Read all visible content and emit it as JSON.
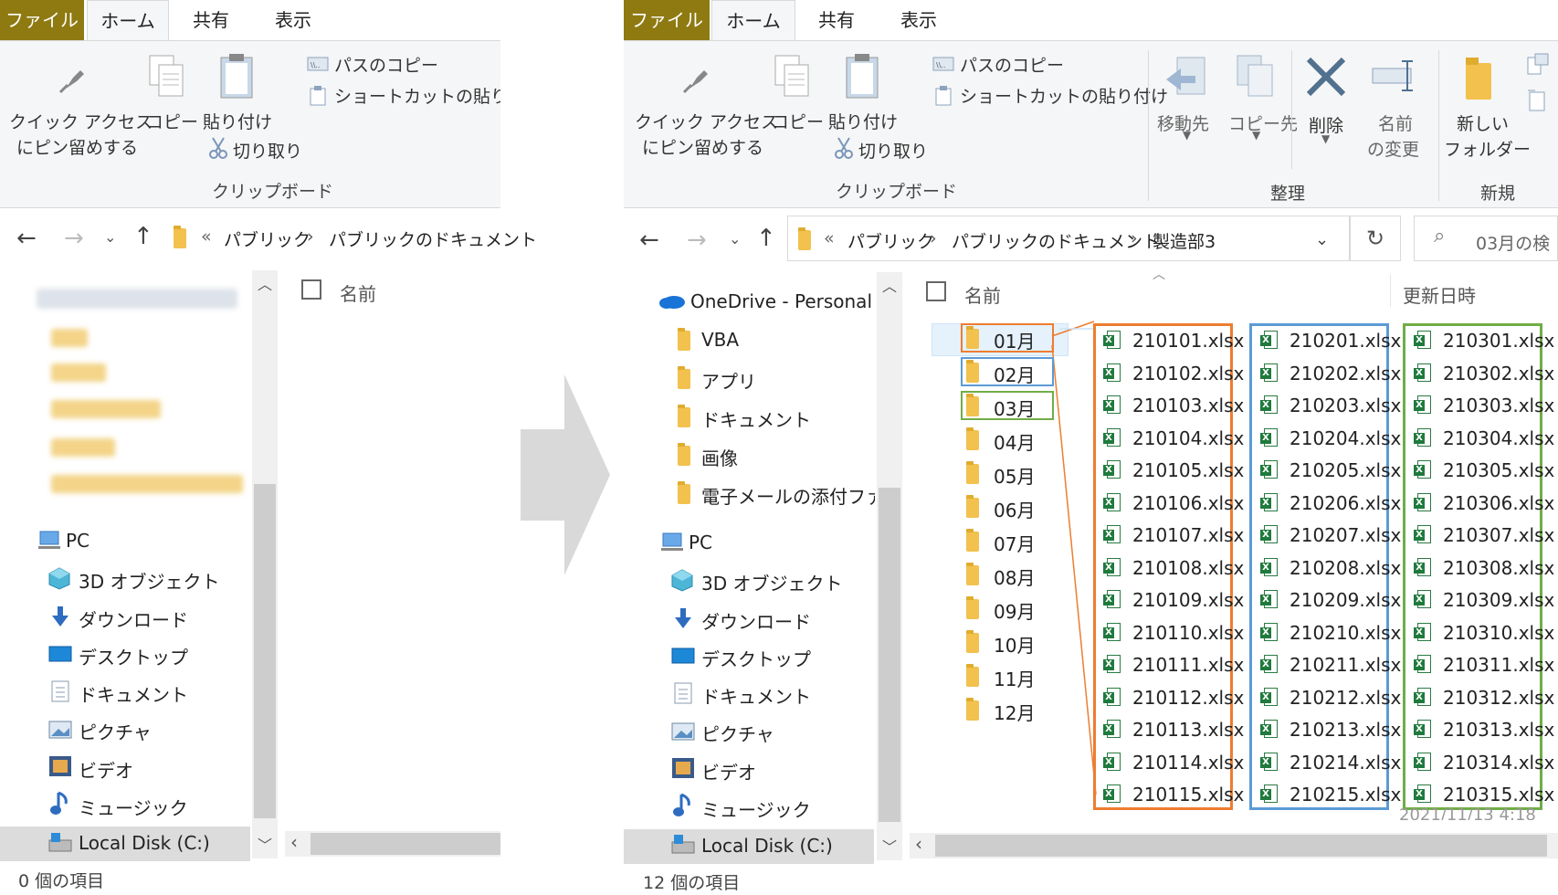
{
  "ribbon": {
    "tabs": [
      "ファイル",
      "ホーム",
      "共有",
      "表示"
    ],
    "pin_label_1": "クイック アクセス",
    "pin_label_2": "にピン留めする",
    "copy": "コピー",
    "paste": "貼り付け",
    "copy_path": "パスのコピー",
    "paste_shortcut_left": "ショートカットの貼り付け",
    "paste_shortcut_right": "ショートカットの貼り付け",
    "cut": "切り取り",
    "clipboard_group": "クリップボード",
    "move_to": "移動先",
    "copy_to": "コピー先",
    "delete": "削除",
    "rename_1": "名前",
    "rename_2": "の変更",
    "organize_group": "整理",
    "new_folder_1": "新しい",
    "new_folder_2": "フォルダー",
    "new_group": "新規"
  },
  "address": {
    "chevrons": "«",
    "left_path": [
      "パブリック",
      "パブリックのドキュメント"
    ],
    "right_path": [
      "パブリック",
      "パブリックのドキュメント",
      "製造部3"
    ],
    "search_placeholder": "03月の検"
  },
  "columns": {
    "name": "名前",
    "modified": "更新日時"
  },
  "nav_left": [
    "PC",
    "3D オブジェクト",
    "ダウンロード",
    "デスクトップ",
    "ドキュメント",
    "ピクチャ",
    "ビデオ",
    "ミュージック",
    "Local Disk (C:)"
  ],
  "nav_right_top": [
    "OneDrive - Personal",
    "VBA",
    "アプリ",
    "ドキュメント",
    "画像",
    "電子メールの添付ファイ"
  ],
  "nav_right_bottom": [
    "PC",
    "3D オブジェクト",
    "ダウンロード",
    "デスクトップ",
    "ドキュメント",
    "ピクチャ",
    "ビデオ",
    "ミュージック",
    "Local Disk (C:)"
  ],
  "months": [
    "01月",
    "02月",
    "03月",
    "04月",
    "05月",
    "06月",
    "07月",
    "08月",
    "09月",
    "10月",
    "11月",
    "12月"
  ],
  "files_jan": [
    "210101.xlsx",
    "210102.xlsx",
    "210103.xlsx",
    "210104.xlsx",
    "210105.xlsx",
    "210106.xlsx",
    "210107.xlsx",
    "210108.xlsx",
    "210109.xlsx",
    "210110.xlsx",
    "210111.xlsx",
    "210112.xlsx",
    "210113.xlsx",
    "210114.xlsx",
    "210115.xlsx"
  ],
  "files_feb": [
    "210201.xlsx",
    "210202.xlsx",
    "210203.xlsx",
    "210204.xlsx",
    "210205.xlsx",
    "210206.xlsx",
    "210207.xlsx",
    "210208.xlsx",
    "210209.xlsx",
    "210210.xlsx",
    "210211.xlsx",
    "210212.xlsx",
    "210213.xlsx",
    "210214.xlsx",
    "210215.xlsx"
  ],
  "files_mar": [
    "210301.xlsx",
    "210302.xlsx",
    "210303.xlsx",
    "210304.xlsx",
    "210305.xlsx",
    "210306.xlsx",
    "210307.xlsx",
    "210308.xlsx",
    "210309.xlsx",
    "210310.xlsx",
    "210311.xlsx",
    "210312.xlsx",
    "210313.xlsx",
    "210314.xlsx",
    "210315.xlsx"
  ],
  "partial_date": "2021/11/13 4:18",
  "status_left": "0 個の項目",
  "status_right": "12 個の項目",
  "colors": {
    "orange": "#ed7d31",
    "blue": "#5b9bd5",
    "green": "#70ad47",
    "file_tab": "#8f7a12"
  }
}
